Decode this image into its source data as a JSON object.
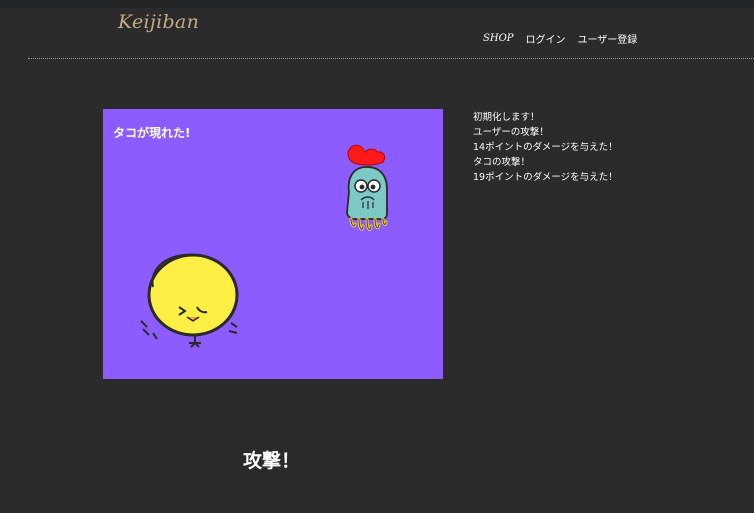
{
  "header": {
    "logo": "Keijiban",
    "nav": [
      "SHOP",
      "ログイン",
      "ユーザー登録"
    ]
  },
  "battle": {
    "message": "タコが現れた!",
    "enemy_icon": "octopus-monster-icon",
    "player_icon": "yellow-chick-icon",
    "background_color": "#8c5cff"
  },
  "log": [
    "初期化します！",
    "ユーザーの攻撃！",
    "14ポイントのダメージを与えた！",
    "タコの攻撃！",
    "19ポイントのダメージを与えた！"
  ],
  "attack_button": "攻撃！"
}
